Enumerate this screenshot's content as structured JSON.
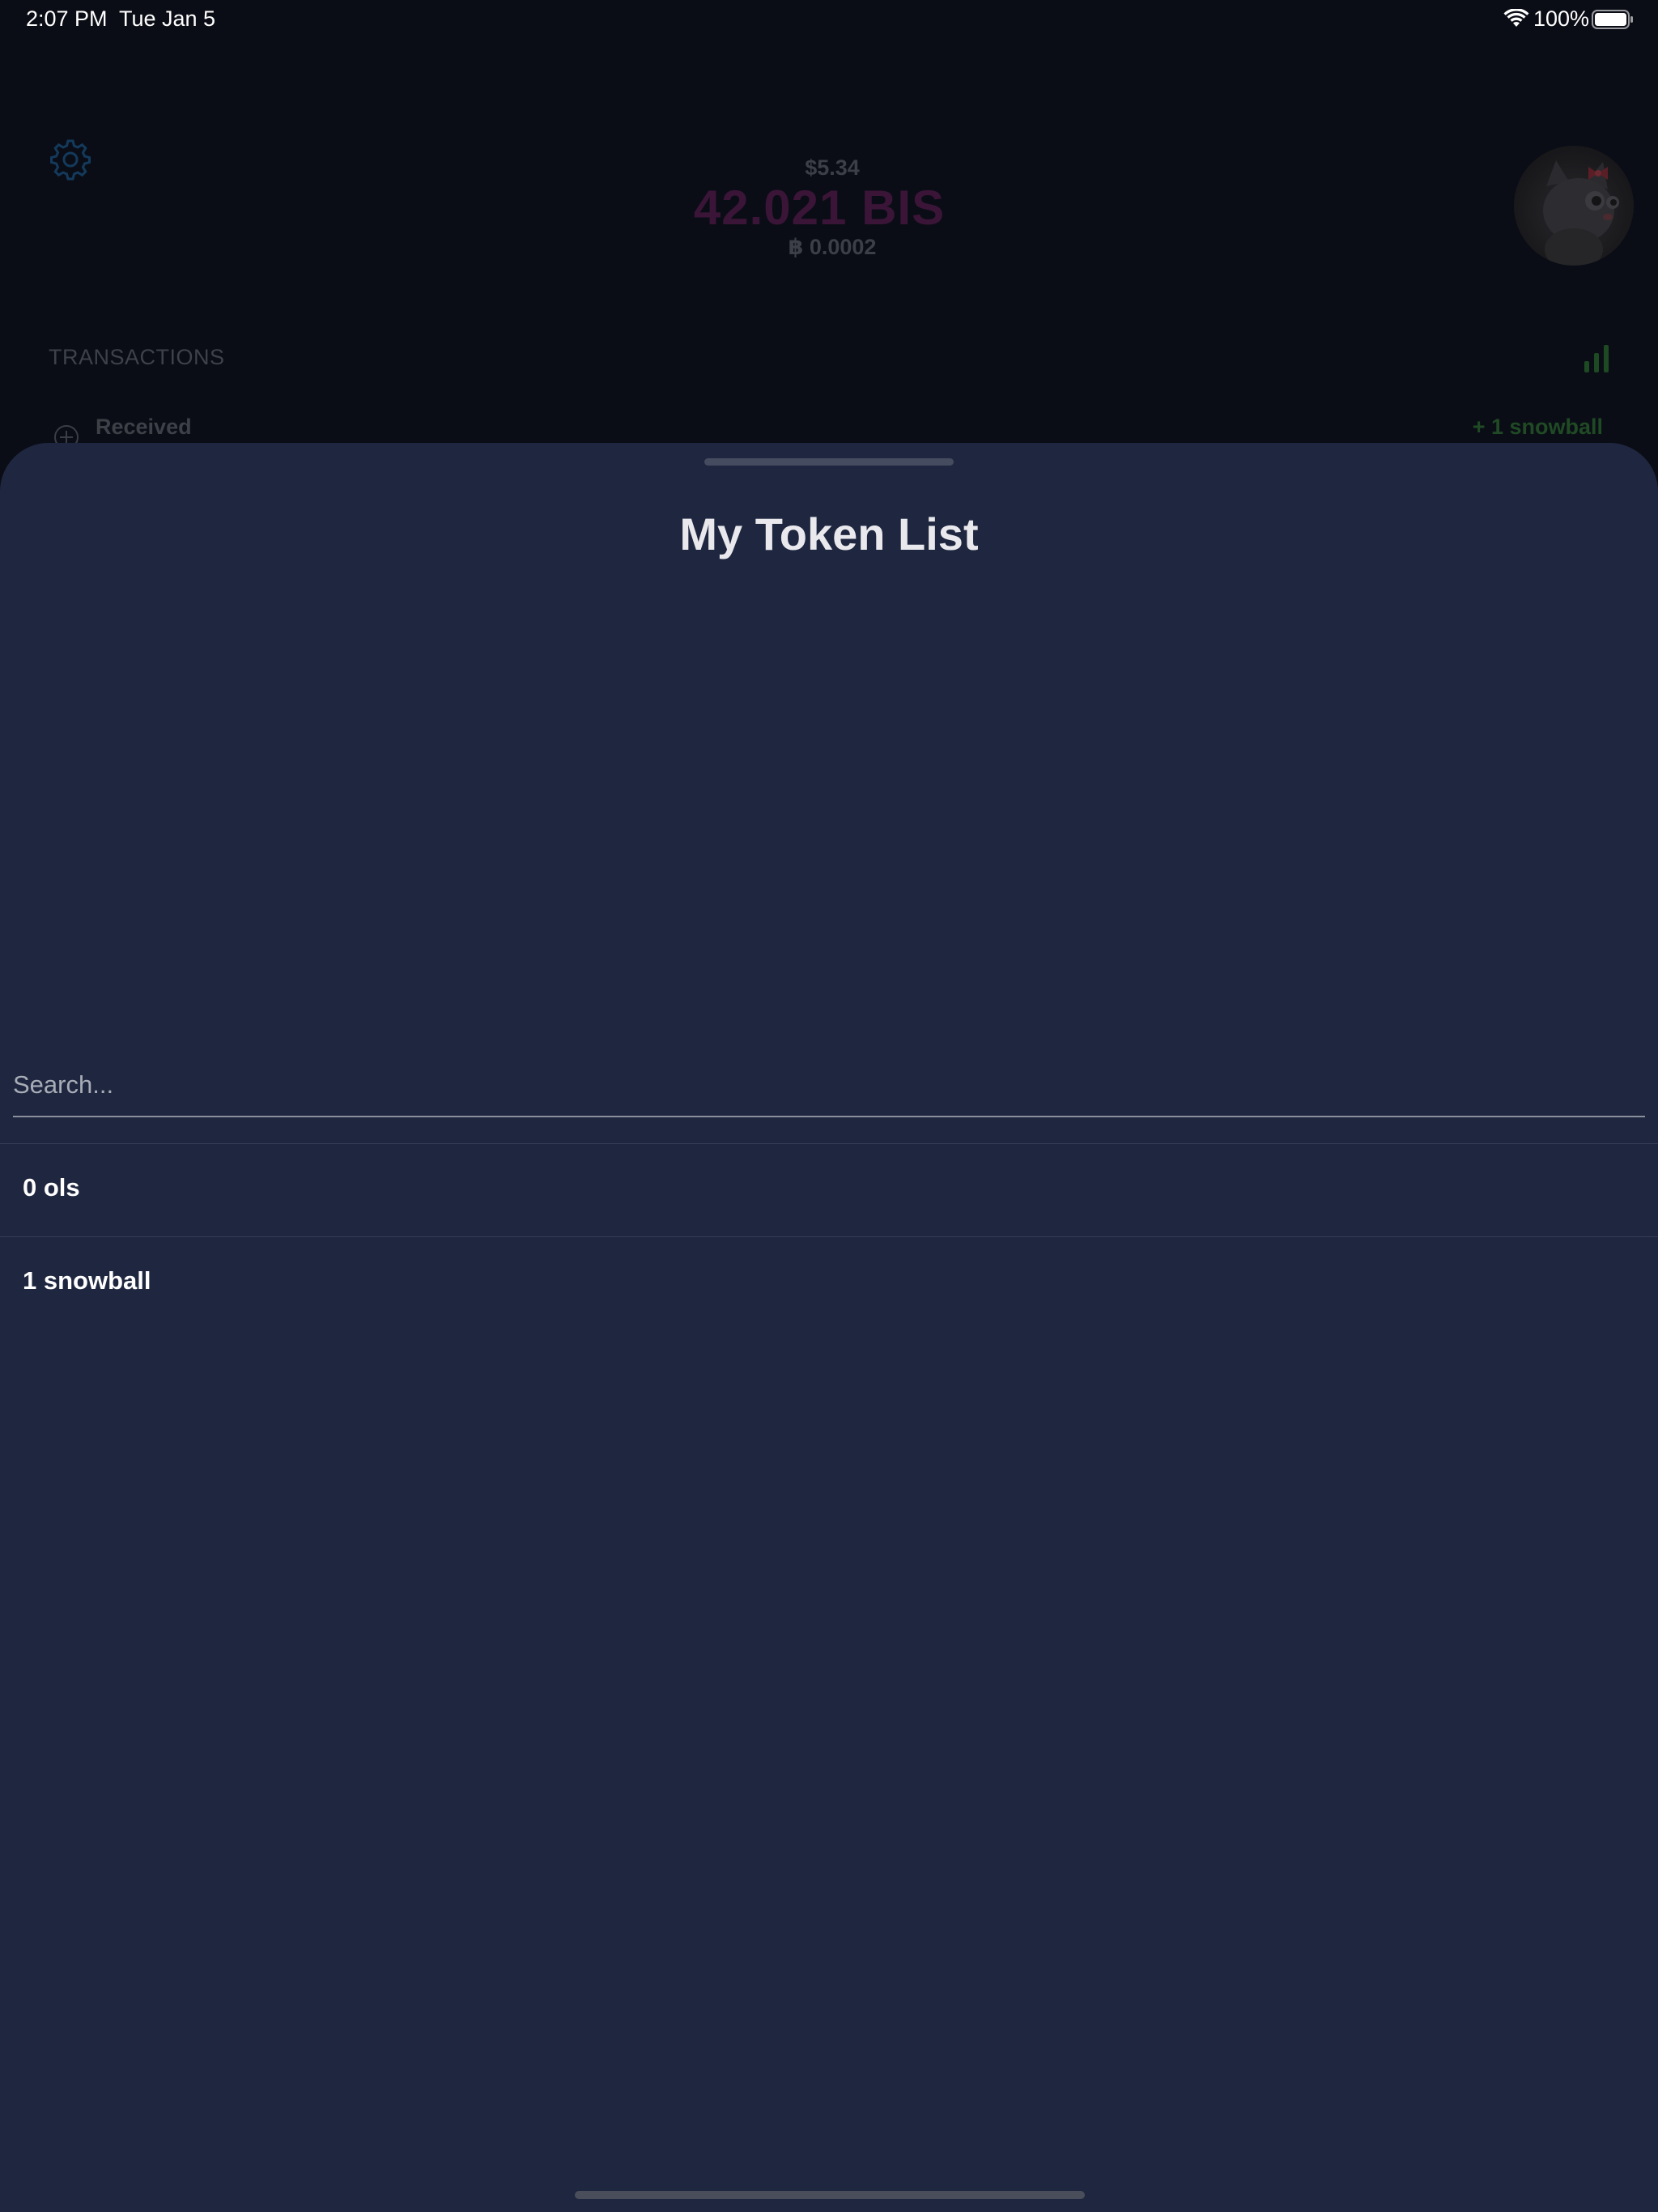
{
  "status_bar": {
    "time": "2:07 PM",
    "date": "Tue Jan 5",
    "battery": "100%"
  },
  "wallet": {
    "balance_usd": "$5.34",
    "balance_bis": "42.021 BIS",
    "balance_btc": "฿ 0.0002",
    "transactions_header": "TRANSACTIONS",
    "transactions": [
      {
        "label": "Received",
        "amount": "+ 1 snowball"
      }
    ]
  },
  "token_sheet": {
    "title": "My Token List",
    "search_placeholder": "Search...",
    "tokens": [
      {
        "label": "0 ols"
      },
      {
        "label": "1 snowball"
      }
    ]
  },
  "colors": {
    "sheet_background": "#1f2740",
    "app_background": "#0b0d16",
    "bis_accent": "#3b1538",
    "received_green": "#1f4a24"
  }
}
